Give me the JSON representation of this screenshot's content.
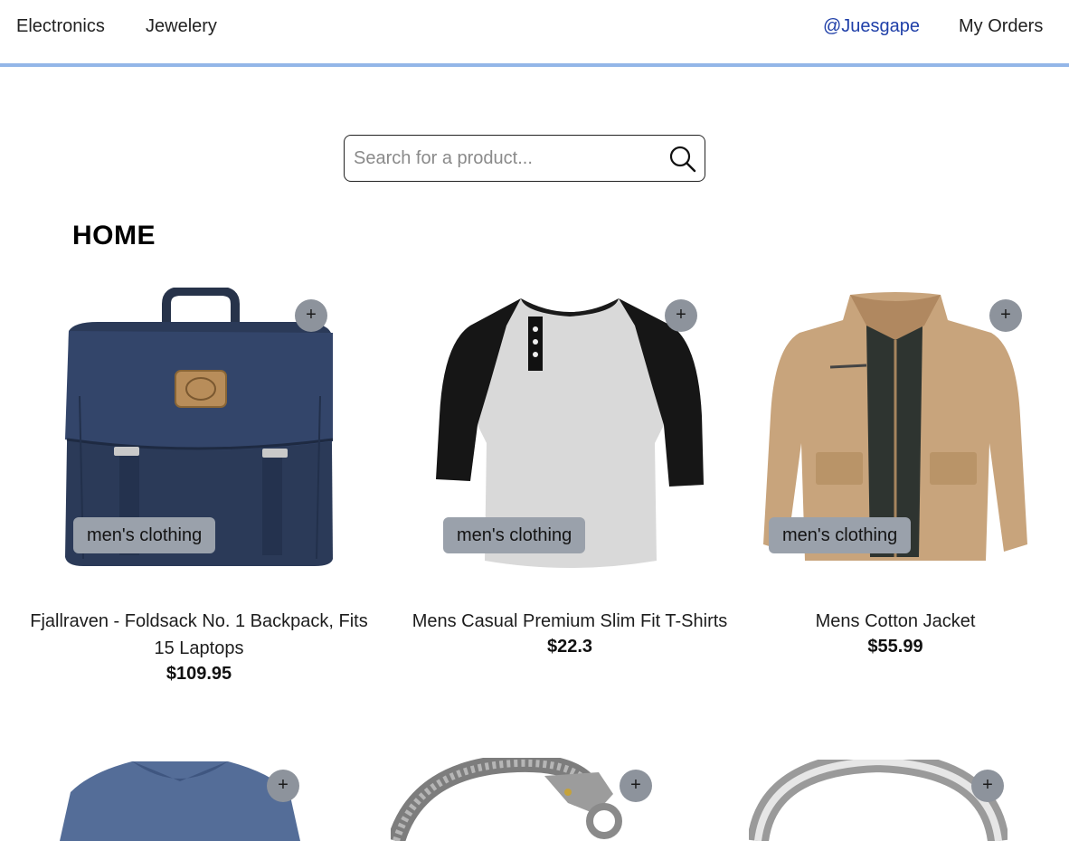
{
  "nav": {
    "left_links": [
      "Electronics",
      "Jewelery"
    ],
    "user_handle": "@Juesgape",
    "orders_label": "My Orders"
  },
  "search": {
    "placeholder": "Search for a product...",
    "value": "",
    "icon": "search-icon"
  },
  "page_title": "HOME",
  "add_label": "+",
  "products": [
    {
      "title": "Fjallraven - Foldsack No. 1 Backpack, Fits 15 Laptops",
      "price": "$109.95",
      "category": "men's clothing"
    },
    {
      "title": "Mens Casual Premium Slim Fit T-Shirts",
      "price": "$22.3",
      "category": "men's clothing"
    },
    {
      "title": "Mens Cotton Jacket",
      "price": "$55.99",
      "category": "men's clothing"
    },
    {
      "title": "",
      "price": "",
      "category": ""
    },
    {
      "title": "",
      "price": "",
      "category": ""
    },
    {
      "title": "",
      "price": "",
      "category": ""
    }
  ],
  "colors": {
    "accent_border": "#93b6e8",
    "user_link": "#1f3fa8",
    "badge_bg": "#9aa1ab",
    "add_button_bg": "#8d939c"
  }
}
